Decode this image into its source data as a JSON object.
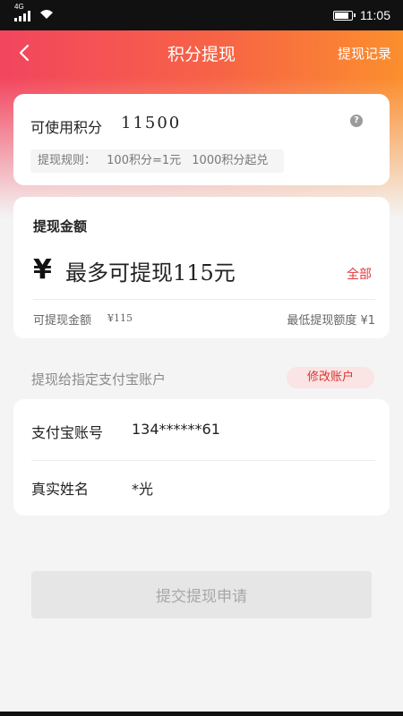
{
  "status_bar": {
    "network": "4G",
    "time": "11:05"
  },
  "nav": {
    "title": "积分提现",
    "record_link": "提现记录"
  },
  "points_card": {
    "label": "可使用积分",
    "value": "11500",
    "help_icon_text": "?",
    "rule_prefix": "提现规则：",
    "rule_rate": "100积分=1元",
    "rule_minimum": "1000积分起兑"
  },
  "amount_card": {
    "title": "提现金额",
    "currency_symbol": "¥",
    "input_placeholder": "最多可提现115元",
    "all_link": "全部",
    "available_label": "可提现金额",
    "available_value": "¥115",
    "min_label": "最低提现额度 ¥1"
  },
  "alipay": {
    "hint": "提现给指定支付宝账户",
    "modify_button": "修改账户",
    "account_label": "支付宝账号",
    "account_value": "134******61",
    "name_label": "真实姓名",
    "name_value": "*光"
  },
  "submit_button": "提交提现申请",
  "colors": {
    "gradient_start": "#f2455f",
    "gradient_end": "#fb8f2d",
    "accent_red": "#e4393c",
    "disabled_button": "#e6e6e6"
  }
}
